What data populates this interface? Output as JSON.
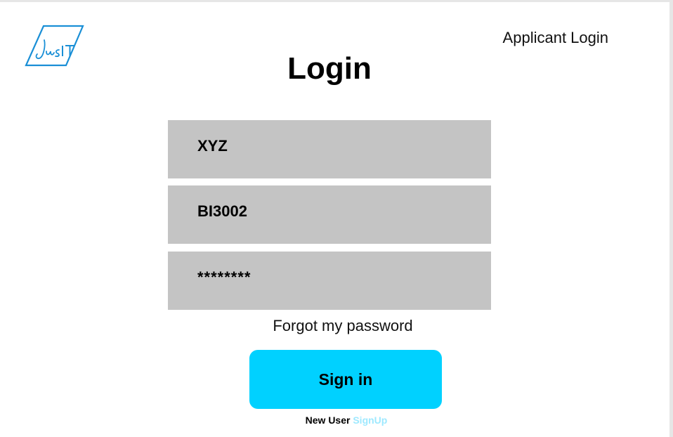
{
  "colors": {
    "accent": "#00d1ff",
    "logo": "#1a8fd6",
    "signup_link": "#9ee9ff",
    "field_background": "#c4c4c4"
  },
  "header": {
    "logo_icon": "jusit-logo-icon",
    "logo_text": "JusIT",
    "applicant_login": "Applicant Login"
  },
  "page": {
    "title": "Login"
  },
  "form": {
    "username_value": "XYZ",
    "id_value": "BI3002",
    "password_value": "********",
    "forgot_password": "Forgot my password",
    "sign_in_label": "Sign in"
  },
  "footer": {
    "new_user_label": "New User",
    "signup_label": "SignUp"
  }
}
